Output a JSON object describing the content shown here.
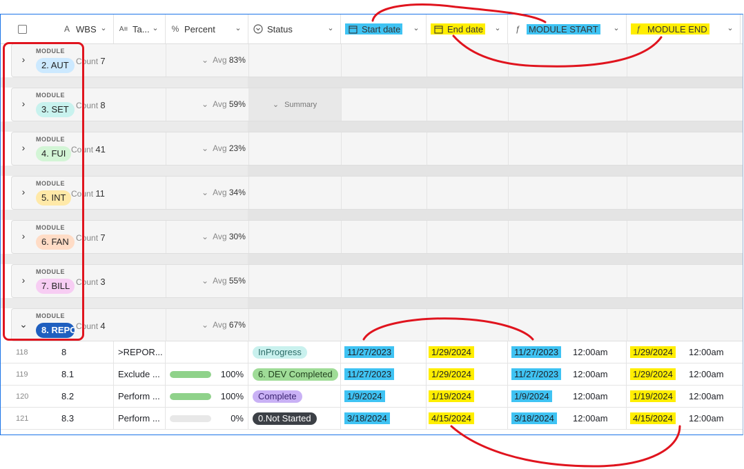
{
  "header": {
    "wbs": "WBS",
    "task": "Ta...",
    "percent": "Percent",
    "status": "Status",
    "start_date": "Start date",
    "end_date": "End date",
    "module_start": "MODULE START",
    "module_end": "MODULE END"
  },
  "group_label": "MODULE",
  "groups": [
    {
      "name": "2. AUT",
      "count_label": "Count",
      "count": "7",
      "avg_label": "Avg",
      "avg": "83%",
      "color": "#cce9ff"
    },
    {
      "name": "3. SET",
      "count_label": "Count",
      "count": "8",
      "avg_label": "Avg",
      "avg": "59%",
      "color": "#c8f2ee",
      "summary": "Summary"
    },
    {
      "name": "4. FUI",
      "count_label": "Count",
      "count": "41",
      "avg_label": "Avg",
      "avg": "23%",
      "color": "#d3f5d6"
    },
    {
      "name": "5. INT",
      "count_label": "Count",
      "count": "11",
      "avg_label": "Avg",
      "avg": "34%",
      "color": "#ffe9a8"
    },
    {
      "name": "6. FAN",
      "count_label": "Count",
      "count": "7",
      "avg_label": "Avg",
      "avg": "30%",
      "color": "#ffdcc6"
    },
    {
      "name": "7. BILL",
      "count_label": "Count",
      "count": "3",
      "avg_label": "Avg",
      "avg": "55%",
      "color": "#f7cdf3"
    },
    {
      "name": "8. REPO",
      "count_label": "Count",
      "count": "4",
      "avg_label": "Avg",
      "avg": "67%",
      "color": "#1f5fbf"
    }
  ],
  "rows": [
    {
      "num": "118",
      "wbs": "8",
      "task": ">REPOR...",
      "percent": "",
      "percent_value": null,
      "status": "InProgress",
      "status_bg": "#c9f1ee",
      "status_fg": "#2b6b66",
      "start": "11/27/2023",
      "end": "1/29/2024",
      "mstart": "11/27/2023",
      "mstart_time": "12:00am",
      "mend": "1/29/2024",
      "mend_time": "12:00am"
    },
    {
      "num": "119",
      "wbs": "8.1",
      "task": "Exclude ...",
      "percent": "100%",
      "percent_value": 1.0,
      "status": "6. DEV Completed",
      "status_bg": "#9fdc97",
      "status_fg": "#1f3f1c",
      "start": "11/27/2023",
      "end": "1/29/2024",
      "mstart": "11/27/2023",
      "mstart_time": "12:00am",
      "mend": "1/29/2024",
      "mend_time": "12:00am"
    },
    {
      "num": "120",
      "wbs": "8.2",
      "task": "Perform ...",
      "percent": "100%",
      "percent_value": 1.0,
      "status": "Complete",
      "status_bg": "#c9b1f5",
      "status_fg": "#3a2270",
      "start": "1/9/2024",
      "end": "1/19/2024",
      "mstart": "1/9/2024",
      "mstart_time": "12:00am",
      "mend": "1/19/2024",
      "mend_time": "12:00am"
    },
    {
      "num": "121",
      "wbs": "8.3",
      "task": "Perform ...",
      "percent": "0%",
      "percent_value": 0.0,
      "status": "0.Not Started",
      "status_bg": "#3c4046",
      "status_fg": "#ffffff",
      "start": "3/18/2024",
      "end": "4/15/2024",
      "mstart": "3/18/2024",
      "mstart_time": "12:00am",
      "mend": "4/15/2024",
      "mend_time": "12:00am"
    }
  ],
  "colors": {
    "highlight_blue": "#3fc3f3",
    "highlight_yellow": "#ffee00",
    "annotation_red": "#e0141e"
  }
}
